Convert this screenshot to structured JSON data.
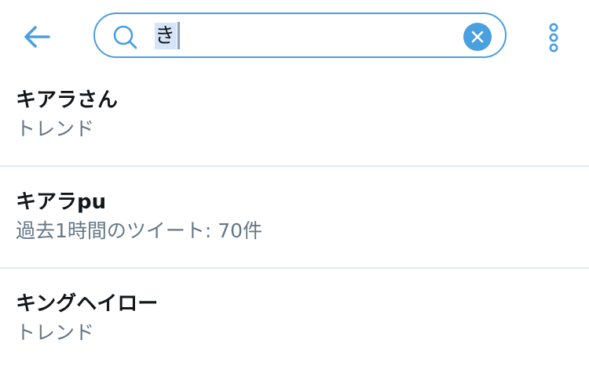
{
  "colors": {
    "accent": "#4a9fe0",
    "text_primary": "#14171a",
    "text_secondary": "#657786",
    "divider": "#e1e8ed",
    "selection": "#d6e4f7"
  },
  "header": {
    "back_icon": "arrow-left-icon",
    "more_icon": "more-vertical-icon"
  },
  "search": {
    "icon": "search-icon",
    "value": "き",
    "clear_icon": "close-icon"
  },
  "results": [
    {
      "title": "キアラさん",
      "subtitle": "トレンド"
    },
    {
      "title": "キアラpu",
      "subtitle": "過去1時間のツイート: 70件"
    },
    {
      "title": "キングヘイロー",
      "subtitle": "トレンド"
    }
  ]
}
